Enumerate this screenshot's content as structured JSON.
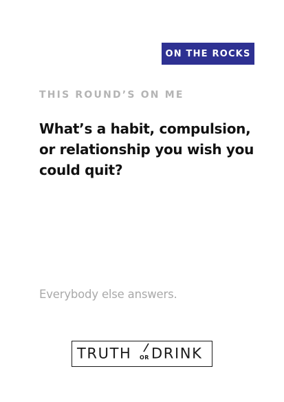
{
  "colors": {
    "badge_background": "#2e3192",
    "background": "#ffffff",
    "question_text": "#111111",
    "muted_text": "#b4b4b4"
  },
  "badge": {
    "label": "ON THE ROCKS"
  },
  "card": {
    "round_label": "THIS ROUND’S ON ME",
    "question": "What’s a habit, compulsion, or relationship you wish you could quit?",
    "instruction": "Everybody else answers."
  },
  "logo": {
    "word_left": "TRUTH",
    "word_middle": "OR",
    "word_right": "DRINK"
  }
}
